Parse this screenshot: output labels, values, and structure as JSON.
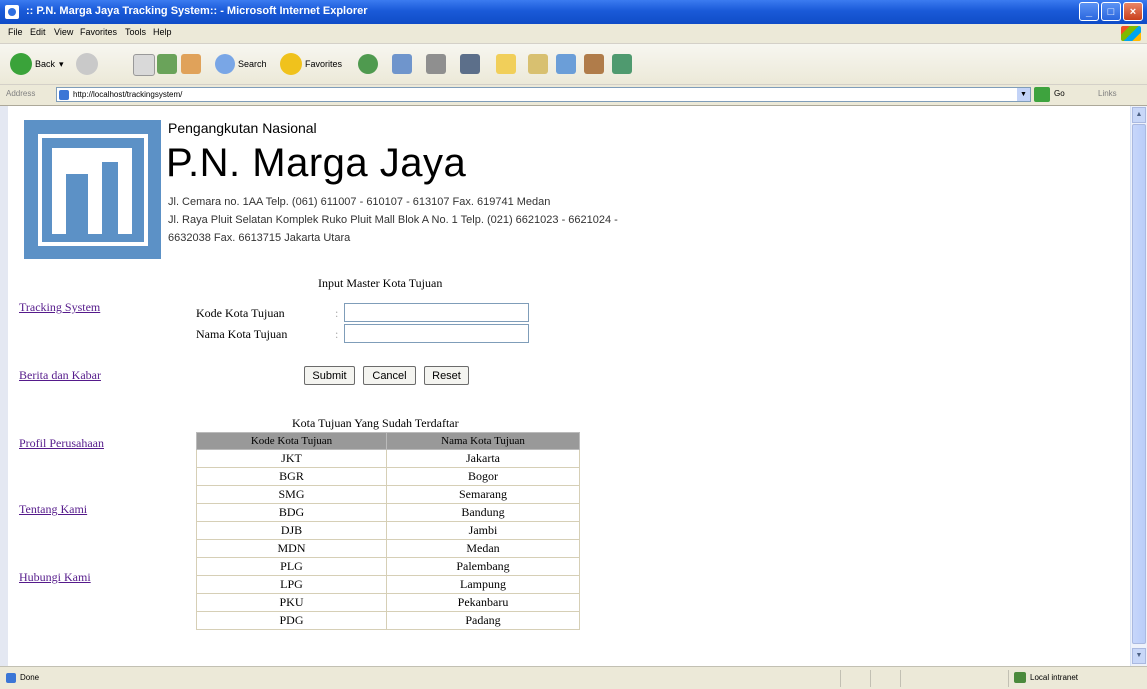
{
  "window": {
    "title": ":: P.N. Marga Jaya Tracking System:: - Microsoft Internet Explorer"
  },
  "menu": [
    "File",
    "Edit",
    "View",
    "Favorites",
    "Tools",
    "Help"
  ],
  "toolbar": {
    "back": "Back",
    "search": "Search",
    "favorites": "Favorites"
  },
  "address": {
    "label": "Address",
    "url": "http://localhost/trackingsystem/",
    "go": "Go",
    "links": "Links"
  },
  "company": {
    "subtitle": "Pengangkutan Nasional",
    "name": "P.N. Marga Jaya",
    "address_lines": [
      "Jl. Cemara no. 1AA Telp. (061) 611007 - 610107 - 613107 Fax. 619741 Medan",
      "Jl. Raya Pluit Selatan Komplek Ruko Pluit Mall Blok A No. 1 Telp. (021) 6621023 - 6621024 -",
      "6632038 Fax. 6613715 Jakarta Utara"
    ]
  },
  "nav": [
    "Tracking System",
    "Berita dan Kabar",
    "Profil Perusahaan",
    "Tentang Kami",
    "Hubungi Kami"
  ],
  "form": {
    "title": "Input Master Kota Tujuan",
    "fields": [
      {
        "label": "Kode Kota Tujuan",
        "colon": ":",
        "value": ""
      },
      {
        "label": "Nama Kota Tujuan",
        "colon": ":",
        "value": ""
      }
    ],
    "buttons": {
      "submit": "Submit",
      "cancel": "Cancel",
      "reset": "Reset"
    }
  },
  "list": {
    "title": "Kota Tujuan Yang Sudah Terdaftar",
    "columns": [
      "Kode Kota Tujuan",
      "Nama Kota Tujuan"
    ],
    "rows": [
      [
        "JKT",
        "Jakarta"
      ],
      [
        "BGR",
        "Bogor"
      ],
      [
        "SMG",
        "Semarang"
      ],
      [
        "BDG",
        "Bandung"
      ],
      [
        "DJB",
        "Jambi"
      ],
      [
        "MDN",
        "Medan"
      ],
      [
        "PLG",
        "Palembang"
      ],
      [
        "LPG",
        "Lampung"
      ],
      [
        "PKU",
        "Pekanbaru"
      ],
      [
        "PDG",
        "Padang"
      ]
    ]
  },
  "status": {
    "text": "Done",
    "zone": "Local intranet"
  }
}
